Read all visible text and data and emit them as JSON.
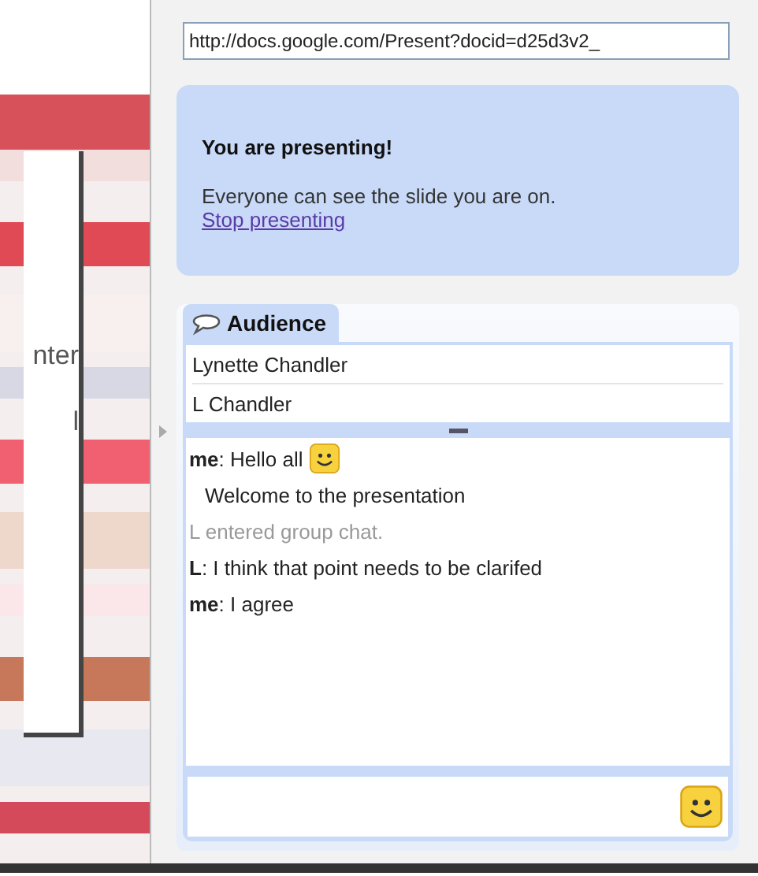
{
  "slide_preview": {
    "card_texts": [
      "nter",
      "l"
    ]
  },
  "url_field": {
    "value": "http://docs.google.com/Present?docid=d25d3v2_"
  },
  "notice": {
    "title": "You are presenting!",
    "text": "Everyone can see the slide you are on.",
    "link": "Stop presenting"
  },
  "tabs": [
    {
      "label": "Audience",
      "selected": true
    }
  ],
  "audience": [
    "Lynette Chandler",
    "L Chandler"
  ],
  "chat": [
    {
      "kind": "message",
      "text": "**me**: Hello all",
      "emoticon": true
    },
    {
      "kind": "continuation",
      "text": "Welcome to the presentation",
      "emoticon": false
    },
    {
      "kind": "system",
      "text": "L entered group chat.",
      "emoticon": false
    },
    {
      "kind": "message",
      "text": "**L**: I think that point needs to be clarifed",
      "emoticon": false
    },
    {
      "kind": "message",
      "text": "**me**: I agree",
      "emoticon": false
    }
  ]
}
